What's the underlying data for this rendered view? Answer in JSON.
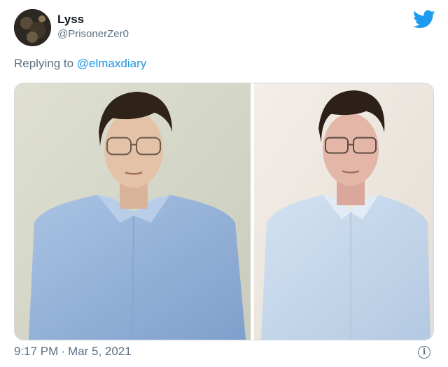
{
  "author": {
    "name": "Lyss",
    "handle": "@PrisonerZer0"
  },
  "reply": {
    "prefix": "Replying to",
    "mention": "@elmaxdiary"
  },
  "media": {
    "count": 2,
    "items": [
      {
        "kind": "photo",
        "icon": "portrait"
      },
      {
        "kind": "photo",
        "icon": "portrait"
      }
    ]
  },
  "meta": {
    "time": "9:17 PM",
    "separator": "·",
    "date": "Mar 5, 2021"
  },
  "icons": {
    "brand": "twitter-bird-icon",
    "info": "info-icon"
  },
  "colors": {
    "brand": "#1d9bf0",
    "link": "#1b95e0",
    "secondary_text": "#5b7083"
  }
}
